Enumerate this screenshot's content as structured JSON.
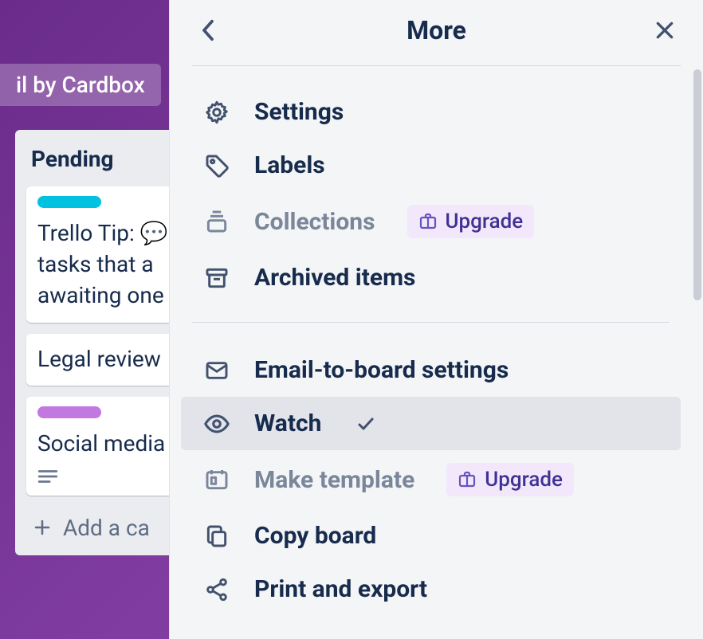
{
  "board": {
    "button_label": "il by Cardbox"
  },
  "list": {
    "title": "Pending",
    "cards": [
      {
        "label_color": "teal",
        "lines": [
          "Trello Tip: 💬",
          "tasks that a",
          "awaiting one"
        ]
      },
      {
        "label_color": null,
        "lines": [
          "Legal review"
        ]
      },
      {
        "label_color": "purple",
        "lines": [
          "Social media"
        ],
        "has_description": true
      }
    ],
    "add_label": "Add a ca"
  },
  "panel": {
    "title": "More",
    "sections": [
      [
        {
          "id": "settings",
          "icon": "gear-icon",
          "label": "Settings"
        },
        {
          "id": "labels",
          "icon": "tag-icon",
          "label": "Labels"
        },
        {
          "id": "collections",
          "icon": "stack-icon",
          "label": "Collections",
          "disabled": true,
          "badge": "Upgrade"
        },
        {
          "id": "archived",
          "icon": "archive-icon",
          "label": "Archived items"
        }
      ],
      [
        {
          "id": "email",
          "icon": "mail-icon",
          "label": "Email-to-board settings"
        },
        {
          "id": "watch",
          "icon": "eye-icon",
          "label": "Watch",
          "checked": true,
          "hovered": true
        },
        {
          "id": "template",
          "icon": "template-icon",
          "label": "Make template",
          "disabled": true,
          "badge": "Upgrade"
        },
        {
          "id": "copy",
          "icon": "copy-icon",
          "label": "Copy board"
        },
        {
          "id": "print",
          "icon": "share-icon",
          "label": "Print and export"
        }
      ]
    ]
  }
}
